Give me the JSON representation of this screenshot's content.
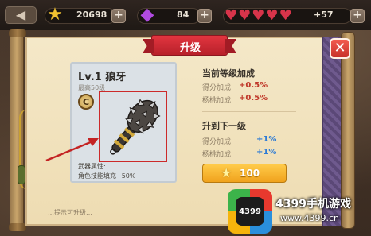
{
  "topbar": {
    "back_glyph": "◀",
    "gold_value": "20698",
    "gem_value": "84",
    "hearts_count": 5,
    "hearts_extra": "+57",
    "plus_glyph": "+"
  },
  "dialog": {
    "title": "升级",
    "close_glyph": "✕"
  },
  "item": {
    "name": "Lv.1 狼牙",
    "max_level": "最高50级",
    "rank": "C",
    "desc_label": "武器属性:",
    "desc_value": "角色技能填充+50%"
  },
  "current": {
    "title": "当前等级加成",
    "rows": [
      {
        "label": "得分加成:",
        "value": "+0.5%"
      },
      {
        "label": "杨桃加成:",
        "value": "+0.5%"
      }
    ]
  },
  "next": {
    "title": "升到下一级",
    "rows": [
      {
        "label": "得分加成",
        "value": "+1%"
      },
      {
        "label": "杨桃加成",
        "value": "+1%"
      }
    ]
  },
  "upgrade": {
    "cost": "100"
  },
  "bottom_hint": "…提示可升级…",
  "watermark": {
    "logo_text": "4399",
    "title": "4399手机游戏",
    "url": "www.4399.cn"
  },
  "colors": {
    "current_value": "#c0392b",
    "next_value": "#2d7bd6",
    "accent_banner": "#d02a33"
  }
}
